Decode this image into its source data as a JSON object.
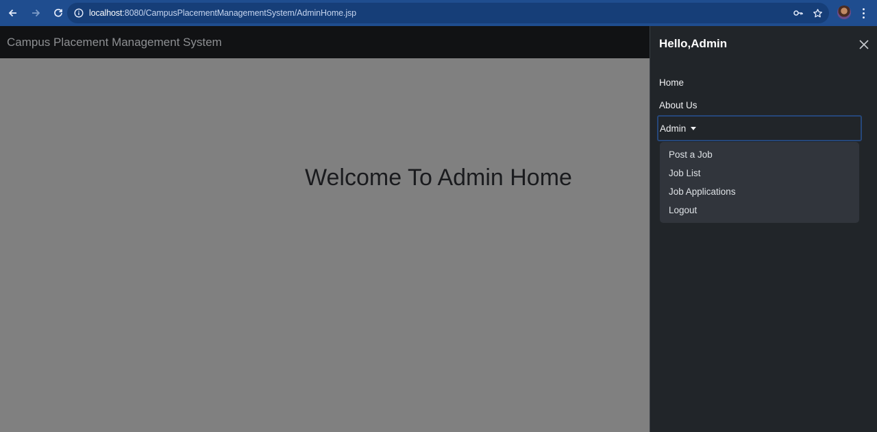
{
  "browser": {
    "url_host": "localhost",
    "url_rest": ":8080/CampusPlacementManagementSystem/AdminHome.jsp",
    "icons": {
      "back": "arrow-left-icon",
      "forward": "arrow-right-icon",
      "reload": "reload-icon",
      "site_info": "info-icon",
      "password": "key-icon",
      "bookmark": "star-icon",
      "menu": "vertical-dots-icon"
    }
  },
  "navbar": {
    "brand": "Campus Placement Management System"
  },
  "main": {
    "welcome": "Welcome To Admin Home"
  },
  "offcanvas": {
    "title": "Hello,Admin",
    "links": {
      "home": "Home",
      "about": "About Us",
      "admin": "Admin"
    },
    "dropdown": [
      "Post a Job",
      "Job List",
      "Job Applications",
      "Logout"
    ]
  },
  "colors": {
    "browser_bar": "#1f4d8f",
    "navbar": "#111214",
    "backdrop": "#808080",
    "offcanvas": "#212529",
    "dropdown": "#31353c",
    "focus_border": "#26477a"
  }
}
